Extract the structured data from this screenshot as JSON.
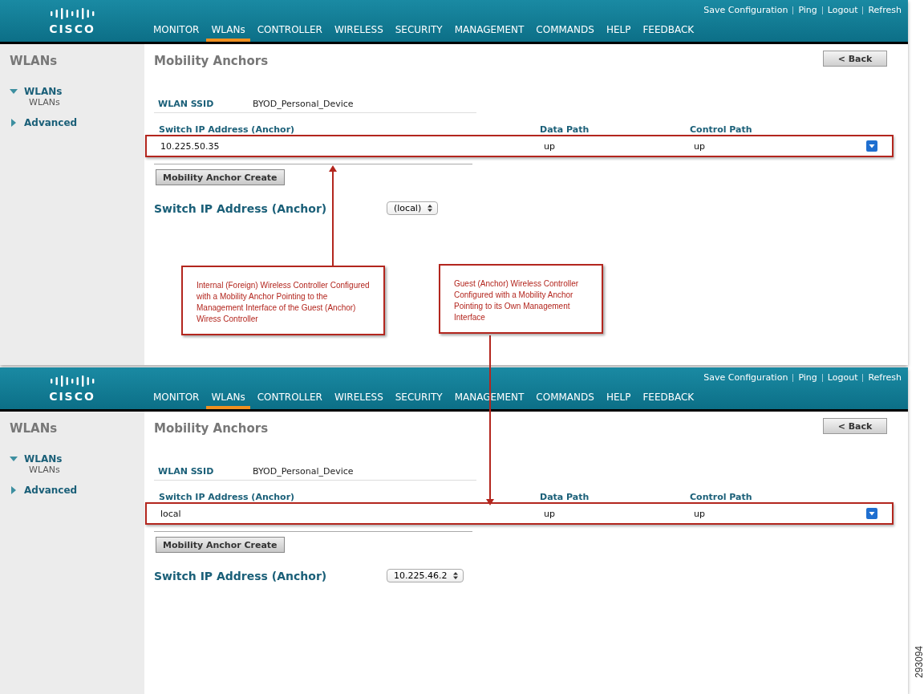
{
  "panels": [
    {
      "header": {
        "links": [
          "Save Configuration",
          "Ping",
          "Logout",
          "Refresh"
        ],
        "nav": [
          {
            "label": "MONITOR",
            "selected": false
          },
          {
            "label": "WLANs",
            "selected": true
          },
          {
            "label": "CONTROLLER",
            "selected": false
          },
          {
            "label": "WIRELESS",
            "selected": false
          },
          {
            "label": "SECURITY",
            "selected": false
          },
          {
            "label": "MANAGEMENT",
            "selected": false
          },
          {
            "label": "COMMANDS",
            "selected": false
          },
          {
            "label": "HELP",
            "selected": false
          },
          {
            "label": "FEEDBACK",
            "selected": false
          }
        ],
        "logo": "CISCO"
      },
      "sidebar": {
        "title": "WLANs",
        "items": [
          {
            "label": "WLANs",
            "expanded": true,
            "children": [
              {
                "label": "WLANs"
              }
            ]
          },
          {
            "label": "Advanced",
            "expanded": false
          }
        ]
      },
      "page_title": "Mobility Anchors",
      "back_button": "< Back",
      "ssid": {
        "label": "WLAN SSID",
        "value": "BYOD_Personal_Device"
      },
      "table": {
        "columns": [
          "Switch IP Address (Anchor)",
          "Data Path",
          "Control Path"
        ],
        "rows": [
          {
            "cells": [
              "10.225.50.35",
              "up",
              "up"
            ],
            "highlighted": true
          }
        ]
      },
      "create_button": "Mobility Anchor Create",
      "anchor_select": {
        "label": "Switch IP Address (Anchor)",
        "value": "(local)"
      }
    },
    {
      "header": {
        "links": [
          "Save Configuration",
          "Ping",
          "Logout",
          "Refresh"
        ],
        "nav": [
          {
            "label": "MONITOR",
            "selected": false
          },
          {
            "label": "WLANs",
            "selected": true
          },
          {
            "label": "CONTROLLER",
            "selected": false
          },
          {
            "label": "WIRELESS",
            "selected": false
          },
          {
            "label": "SECURITY",
            "selected": false
          },
          {
            "label": "MANAGEMENT",
            "selected": false
          },
          {
            "label": "COMMANDS",
            "selected": false
          },
          {
            "label": "HELP",
            "selected": false
          },
          {
            "label": "FEEDBACK",
            "selected": false
          }
        ],
        "logo": "CISCO"
      },
      "sidebar": {
        "title": "WLANs",
        "items": [
          {
            "label": "WLANs",
            "expanded": true,
            "children": [
              {
                "label": "WLANs"
              }
            ]
          },
          {
            "label": "Advanced",
            "expanded": false
          }
        ]
      },
      "page_title": "Mobility Anchors",
      "back_button": "< Back",
      "ssid": {
        "label": "WLAN SSID",
        "value": "BYOD_Personal_Device"
      },
      "table": {
        "columns": [
          "Switch IP Address (Anchor)",
          "Data Path",
          "Control Path"
        ],
        "rows": [
          {
            "cells": [
              "local",
              "up",
              "up"
            ],
            "highlighted": true
          }
        ]
      },
      "create_button": "Mobility Anchor Create",
      "anchor_select": {
        "label": "Switch IP Address (Anchor)",
        "value": "10.225.46.2"
      }
    }
  ],
  "callouts": [
    {
      "text": "Internal (Foreign) Wireless Controller Configured with a Mobility Anchor Pointing to the Management Interface of the Guest (Anchor) Wiress Controller",
      "kind": "pointer-up"
    },
    {
      "text": "Guest (Anchor) Wireless Controller Configured with a Mobility Anchor Pointing to its Own Management Interface",
      "kind": "pointer-down"
    }
  ],
  "figure_id": "293094"
}
